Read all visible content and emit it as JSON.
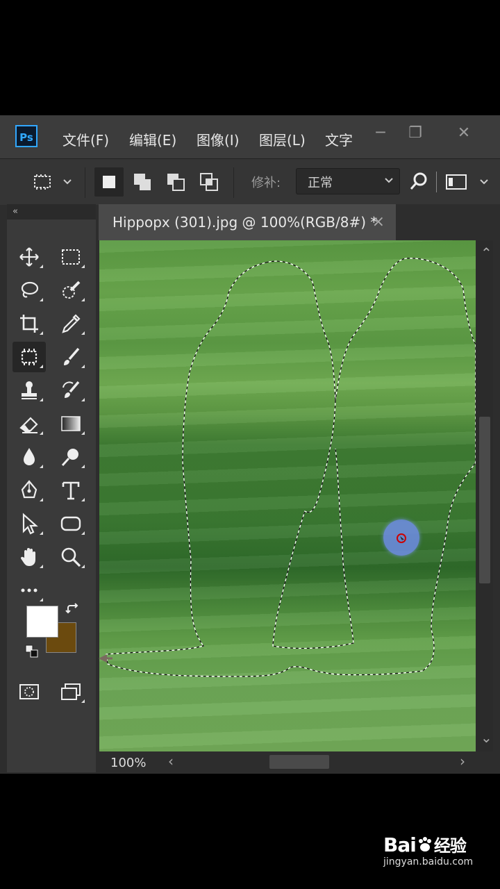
{
  "app": {
    "logo_text": "Ps"
  },
  "menu": {
    "items": [
      "文件(F)",
      "编辑(E)",
      "图像(I)",
      "图层(L)",
      "文字"
    ]
  },
  "window_controls": {
    "minimize": "─",
    "restore": "❐",
    "close": "✕"
  },
  "options_bar": {
    "label": "修补:",
    "mode_value": "正常"
  },
  "toolbar": {
    "collapse": "«"
  },
  "document": {
    "tab_title": "Hippopx (301).jpg @ 100%(RGB/8#) *",
    "close_glyph": "×"
  },
  "status": {
    "zoom": "100%"
  },
  "scroll": {
    "left": "‹",
    "right": "›",
    "up": "⌃",
    "down": "⌄"
  },
  "colors": {
    "foreground": "#ffffff",
    "background": "#6b4a0e",
    "ps_blue": "#31a8ff",
    "grass": "#5e9c45"
  },
  "watermark": {
    "brand": "Bai",
    "brand_cn": "经验",
    "url": "jingyan.baidu.com"
  }
}
